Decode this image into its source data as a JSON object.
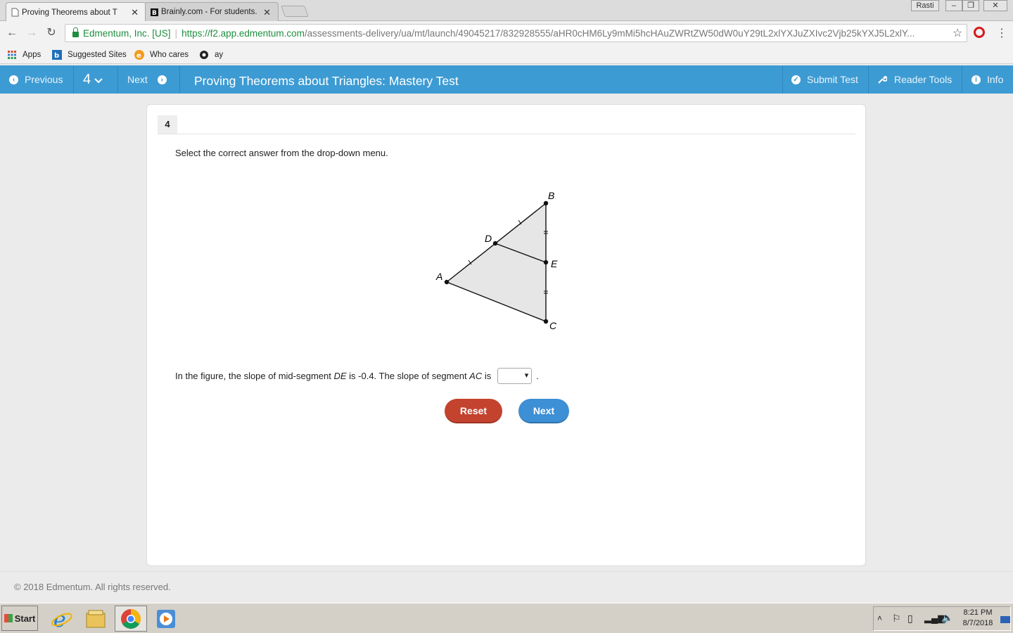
{
  "browser": {
    "tabs": [
      {
        "title": "Proving Theorems about Tri",
        "active": true
      },
      {
        "title": "Brainly.com - For students. ",
        "active": false
      }
    ],
    "window_user": "Rasti",
    "address": {
      "site_name": "Edmentum, Inc. [US]",
      "url_scheme_host": "https://f2.app.edmentum.com",
      "url_path": "/assessments-delivery/ua/mt/launch/49045217/832928555/aHR0cHM6Ly9mMi5hcHAuZWRtZW50dW0uY29tL2xlYXJuZXIvc2Vjb25kYXJ5L2xlY..."
    },
    "bookmarks": [
      {
        "label": "Apps",
        "icon": "apps-grid-icon"
      },
      {
        "label": "Suggested Sites",
        "icon": "bing-icon"
      },
      {
        "label": "Who cares",
        "icon": "orange-e-icon"
      },
      {
        "label": "ay",
        "icon": "edge-like-icon"
      }
    ]
  },
  "header": {
    "previous_label": "Previous",
    "question_number": "4",
    "next_label": "Next",
    "title": "Proving Theorems about Triangles: Mastery Test",
    "submit_label": "Submit Test",
    "reader_tools_label": "Reader Tools",
    "info_label": "Info"
  },
  "question": {
    "number": "4",
    "instruction": "Select the correct answer from the drop-down menu.",
    "figure": {
      "points": {
        "A": "A",
        "B": "B",
        "C": "C",
        "D": "D",
        "E": "E"
      }
    },
    "statement_part1": "In the figure, the slope of mid-segment ",
    "seg_de": "DE",
    "statement_part2": " is -0.4. The slope of segment ",
    "seg_ac": "AC",
    "statement_part3": " is",
    "statement_end": ".",
    "dropdown_value": "",
    "reset_label": "Reset",
    "next_label": "Next"
  },
  "footer": {
    "copyright": "© 2018 Edmentum. All rights reserved."
  },
  "taskbar": {
    "start_label": "Start",
    "time": "8:21 PM",
    "date": "8/7/2018"
  }
}
